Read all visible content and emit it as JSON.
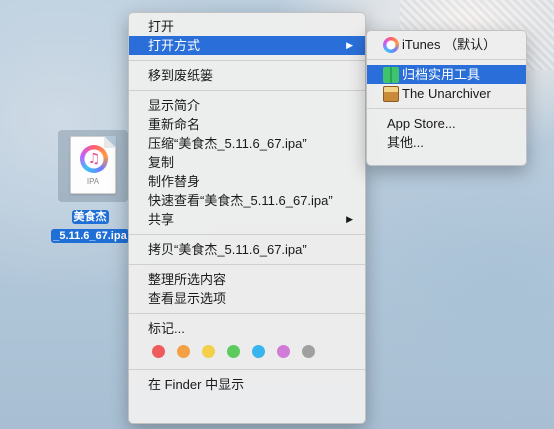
{
  "desktop": {
    "file": {
      "ext": "IPA",
      "label_line1": "美食杰",
      "label_line2": "_5.11.6_67.ipa"
    }
  },
  "context_menu": {
    "open": "打开",
    "open_with": "打开方式",
    "move_to_trash": "移到废纸篓",
    "get_info": "显示简介",
    "rename": "重新命名",
    "compress": "压缩“美食杰_5.11.6_67.ipa”",
    "duplicate": "复制",
    "make_alias": "制作替身",
    "quick_look": "快速查看“美食杰_5.11.6_67.ipa”",
    "share": "共享",
    "copy": "拷贝“美食杰_5.11.6_67.ipa”",
    "clean_up_selection": "整理所选内容",
    "show_view_options": "查看显示选项",
    "tags": "标记...",
    "tag_colors": [
      "#f05b5e",
      "#f6a045",
      "#f3cf4a",
      "#5ccb5d",
      "#38b4ef",
      "#d27ad8",
      "#a0a0a0"
    ],
    "show_in_finder": "在 Finder 中显示"
  },
  "open_with_menu": {
    "itunes": "iTunes （默认）",
    "archive_utility": "归档实用工具",
    "unarchiver": "The Unarchiver",
    "app_store": "App Store...",
    "other": "其他..."
  },
  "colors": {
    "highlight": "#2a6fd9",
    "selection_label": "#1f6fd6"
  }
}
